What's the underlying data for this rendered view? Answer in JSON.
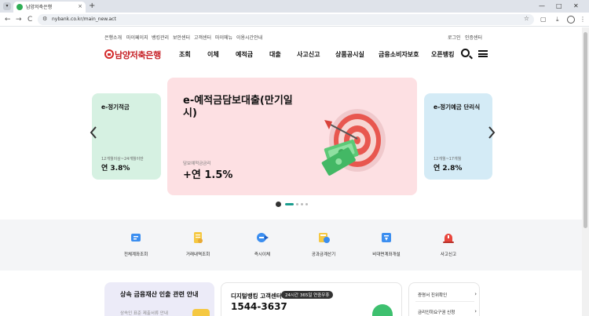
{
  "browser": {
    "tab_title": "남양저축은행",
    "url": "nybank.co.kr/main_new.act",
    "new_tab_symbol": "+",
    "close_symbol": "×",
    "minimize_symbol": "—",
    "maximize_symbol": "□",
    "window_close_symbol": "✕",
    "back_symbol": "←",
    "forward_symbol": "→",
    "reload_symbol": "C",
    "star_symbol": "☆"
  },
  "util_nav": {
    "left": [
      "은행소개",
      "마이페이지",
      "뱅킹관리",
      "보안센터",
      "고객센터",
      "마이메뉴",
      "이용시간안내"
    ],
    "right": [
      "로그인",
      "인증센터"
    ]
  },
  "header": {
    "logo_text": "남양저축은행",
    "menu": [
      "조회",
      "이체",
      "예적금",
      "대출",
      "사고신고",
      "상품공시실",
      "금융소비자보호",
      "오픈뱅킹"
    ]
  },
  "carousel": {
    "left": {
      "title": "e-정기적금",
      "sub": "12개월이상~24개월이만",
      "rate": "연 3.8%"
    },
    "center": {
      "title": "e-예적금담보대출(만기일시)",
      "sub": "담보예적금금리",
      "rate": "+연 1.5%"
    },
    "right": {
      "title": "e-정기예금 단리식",
      "sub": "12개월~17개월",
      "rate": "연 2.8%"
    },
    "slides_count": 4,
    "active_slide": 1
  },
  "quick_menu": [
    {
      "label": "전체계좌조회",
      "icon": "account-list-icon"
    },
    {
      "label": "거래내역조회",
      "icon": "transaction-history-icon"
    },
    {
      "label": "즉시이체",
      "icon": "instant-transfer-icon"
    },
    {
      "label": "공과금계산기",
      "icon": "bill-calculator-icon"
    },
    {
      "label": "비대면계좌개설",
      "icon": "open-account-icon"
    },
    {
      "label": "사고신고",
      "icon": "siren-icon"
    }
  ],
  "bottom": {
    "inherit_title": "상속 금융재산 인출 관련 안내",
    "inherit_sub": "상속인 표준 제출서류 안내",
    "center_title": "디지털뱅킹 고객센터",
    "center_badge": "24시간 365일 연중무휴",
    "center_phone": "1544-3637",
    "links": [
      "증명서 진위확인",
      "금리인하요구권 신청"
    ]
  },
  "colors": {
    "brand_red": "#c62026",
    "accent_teal": "#1b9d8e",
    "card_green": "#d6f1e2",
    "card_pink": "#fde0e3",
    "card_blue": "#d4ebf6"
  }
}
